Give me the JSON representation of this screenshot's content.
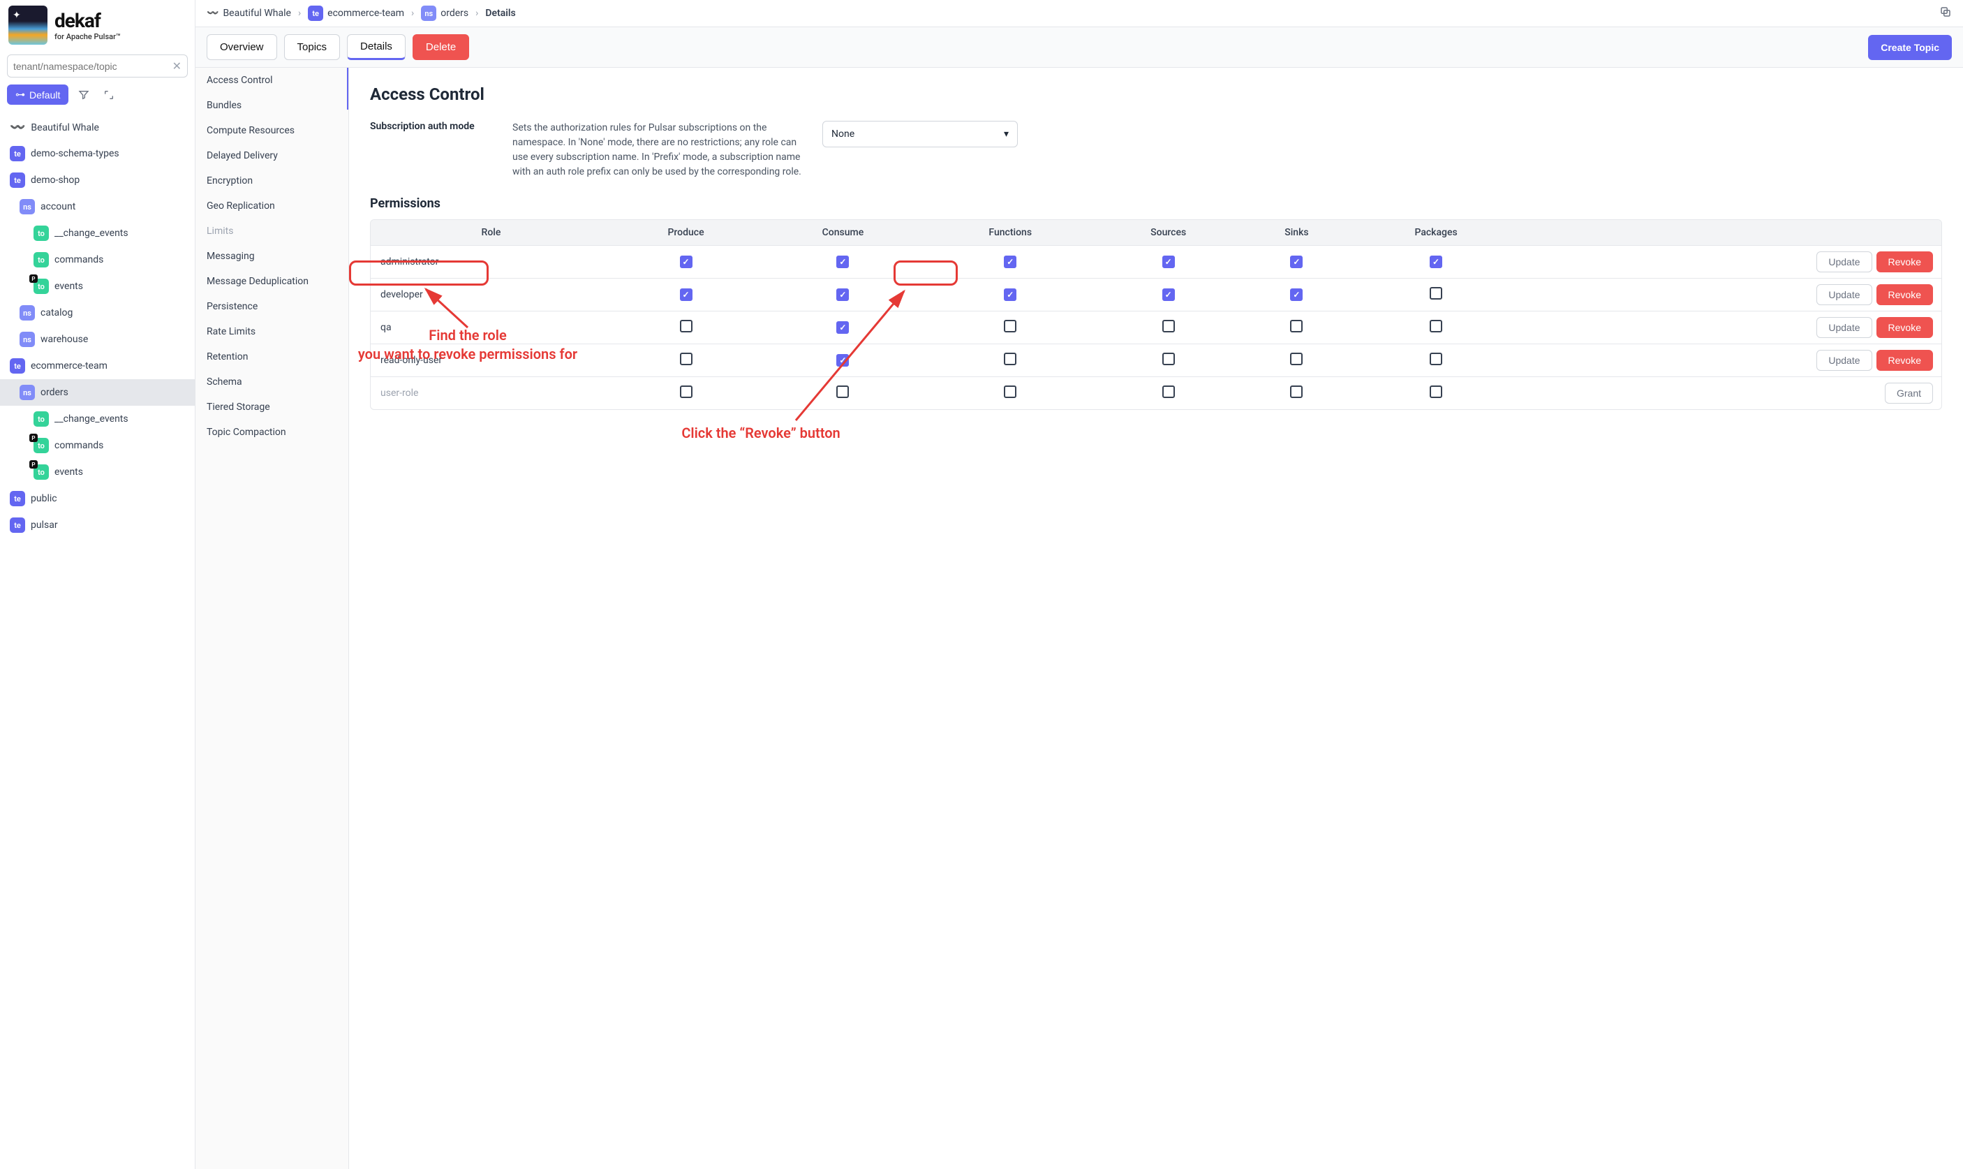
{
  "logo": {
    "title": "dekaf",
    "subtitle": "for Apache Pulsar™"
  },
  "search": {
    "placeholder": "tenant/namespace/topic"
  },
  "default_btn": "Default",
  "tree": {
    "beautiful_whale": "Beautiful Whale",
    "demo_schema": "demo-schema-types",
    "demo_shop": "demo-shop",
    "account": "account",
    "change_events": "__change_events",
    "commands": "commands",
    "events": "events",
    "catalog": "catalog",
    "warehouse": "warehouse",
    "ecommerce_team": "ecommerce-team",
    "orders": "orders",
    "public": "public",
    "pulsar": "pulsar"
  },
  "breadcrumb": {
    "whale": "Beautiful Whale",
    "tenant_badge": "te",
    "tenant": "ecommerce-team",
    "ns_badge": "ns",
    "ns": "orders",
    "current": "Details"
  },
  "tabs": {
    "overview": "Overview",
    "topics": "Topics",
    "details": "Details",
    "delete": "Delete"
  },
  "create_topic": "Create Topic",
  "settings_nav": {
    "access_control": "Access Control",
    "bundles": "Bundles",
    "compute": "Compute Resources",
    "delayed": "Delayed Delivery",
    "encryption": "Encryption",
    "geo": "Geo Replication",
    "limits": "Limits",
    "messaging": "Messaging",
    "dedup": "Message Deduplication",
    "persistence": "Persistence",
    "rate": "Rate Limits",
    "retention": "Retention",
    "schema": "Schema",
    "tiered": "Tiered Storage",
    "compaction": "Topic Compaction"
  },
  "page_title": "Access Control",
  "auth_mode": {
    "label": "Subscription auth mode",
    "desc": "Sets the authorization rules for Pulsar subscriptions on the namespace. In 'None' mode, there are no restrictions; any role can use every subscription name. In 'Prefix' mode, a subscription name with an auth role prefix can only be used by the corresponding role.",
    "value": "None"
  },
  "permissions": {
    "title": "Permissions",
    "headers": {
      "role": "Role",
      "produce": "Produce",
      "consume": "Consume",
      "functions": "Functions",
      "sources": "Sources",
      "sinks": "Sinks",
      "packages": "Packages"
    },
    "rows": [
      {
        "role": "administrator",
        "produce": true,
        "consume": true,
        "functions": true,
        "sources": true,
        "sinks": true,
        "packages": true,
        "update": "Update",
        "revoke": "Revoke"
      },
      {
        "role": "developer",
        "produce": true,
        "consume": true,
        "functions": true,
        "sources": true,
        "sinks": true,
        "packages": false,
        "update": "Update",
        "revoke": "Revoke"
      },
      {
        "role": "qa",
        "produce": false,
        "consume": true,
        "functions": false,
        "sources": false,
        "sinks": false,
        "packages": false,
        "update": "Update",
        "revoke": "Revoke"
      },
      {
        "role": "read-only-user",
        "produce": false,
        "consume": true,
        "functions": false,
        "sources": false,
        "sinks": false,
        "packages": false,
        "update": "Update",
        "revoke": "Revoke"
      },
      {
        "role": "user-role",
        "produce": false,
        "consume": false,
        "functions": false,
        "sources": false,
        "sinks": false,
        "packages": false,
        "grant": "Grant"
      }
    ]
  },
  "annotations": {
    "find_role": "Find the role\nyou want to revoke permissions for",
    "click_revoke": "Click the “Revoke” button"
  }
}
